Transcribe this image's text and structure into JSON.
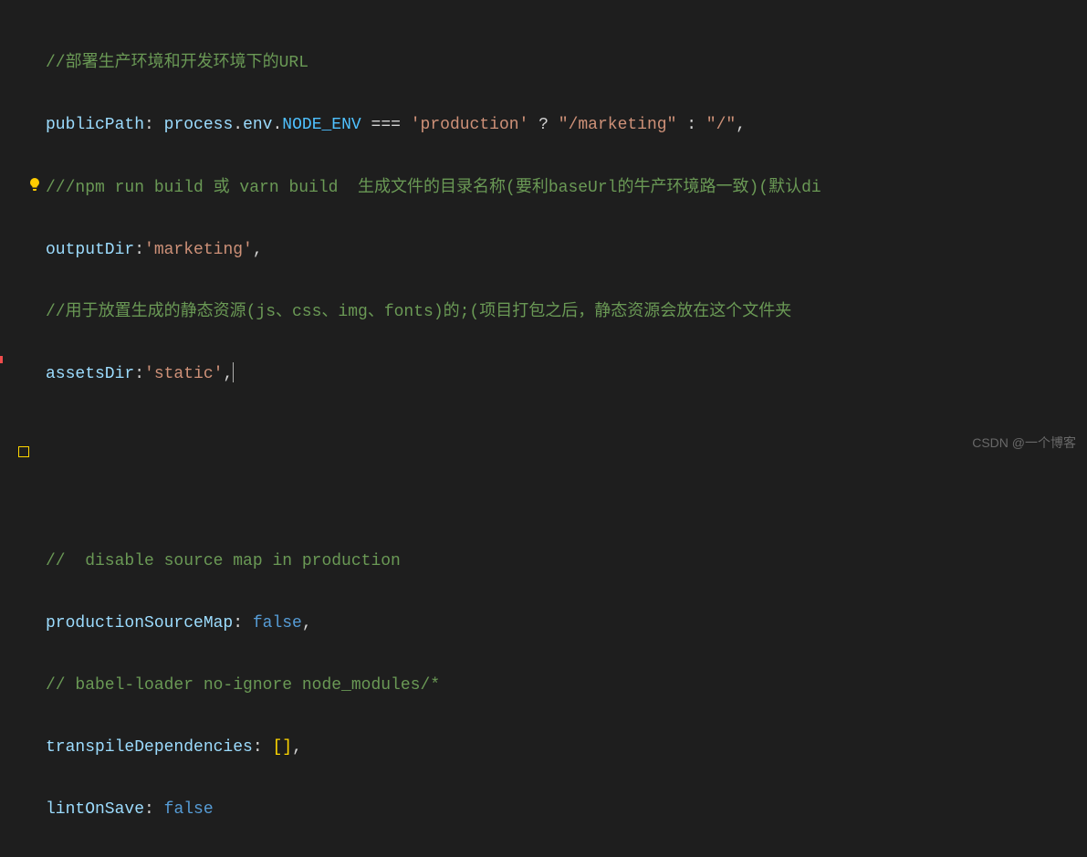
{
  "code": {
    "line1": {
      "comment": "//部署生产环境和开发环境下的URL"
    },
    "line2": {
      "prop": "publicPath",
      "colon": ": ",
      "proc": "process",
      "dot1": ".",
      "env": "env",
      "dot2": ".",
      "nodeenv": "NODE_ENV",
      "eq": " === ",
      "str1": "'production'",
      "tern1": " ? ",
      "str2": "\"/marketing\"",
      "tern2": " : ",
      "str3": "\"/\"",
      "comma": ","
    },
    "line3": {
      "comment": "///npm run build 或 varn build  生成文件的目录名称(要利baseUrl的牛产环境路一致)(默认di"
    },
    "line4": {
      "prop": "outputDir",
      "colon": ":",
      "str": "'marketing'",
      "comma": ","
    },
    "line5": {
      "comment": "//用于放置生成的静态资源(js、css、img、fonts)的;(项目打包之后，静态资源会放在这个文件夹"
    },
    "line6": {
      "prop": "assetsDir",
      "colon": ":",
      "str": "'static'",
      "comma": ","
    },
    "line9": {
      "comment": "//  disable source map in production"
    },
    "line10": {
      "prop": "productionSourceMap",
      "colon": ": ",
      "val": "false",
      "comma": ","
    },
    "line11": {
      "comment": "// babel-loader no-ignore node_modules/*"
    },
    "line12": {
      "prop": "transpileDependencies",
      "colon": ": ",
      "bracket1": "[",
      "bracket2": "]",
      "comma": ","
    },
    "line13": {
      "prop": "lintOnSave",
      "colon": ": ",
      "val": "false"
    }
  },
  "watermark": "CSDN @一个博客"
}
